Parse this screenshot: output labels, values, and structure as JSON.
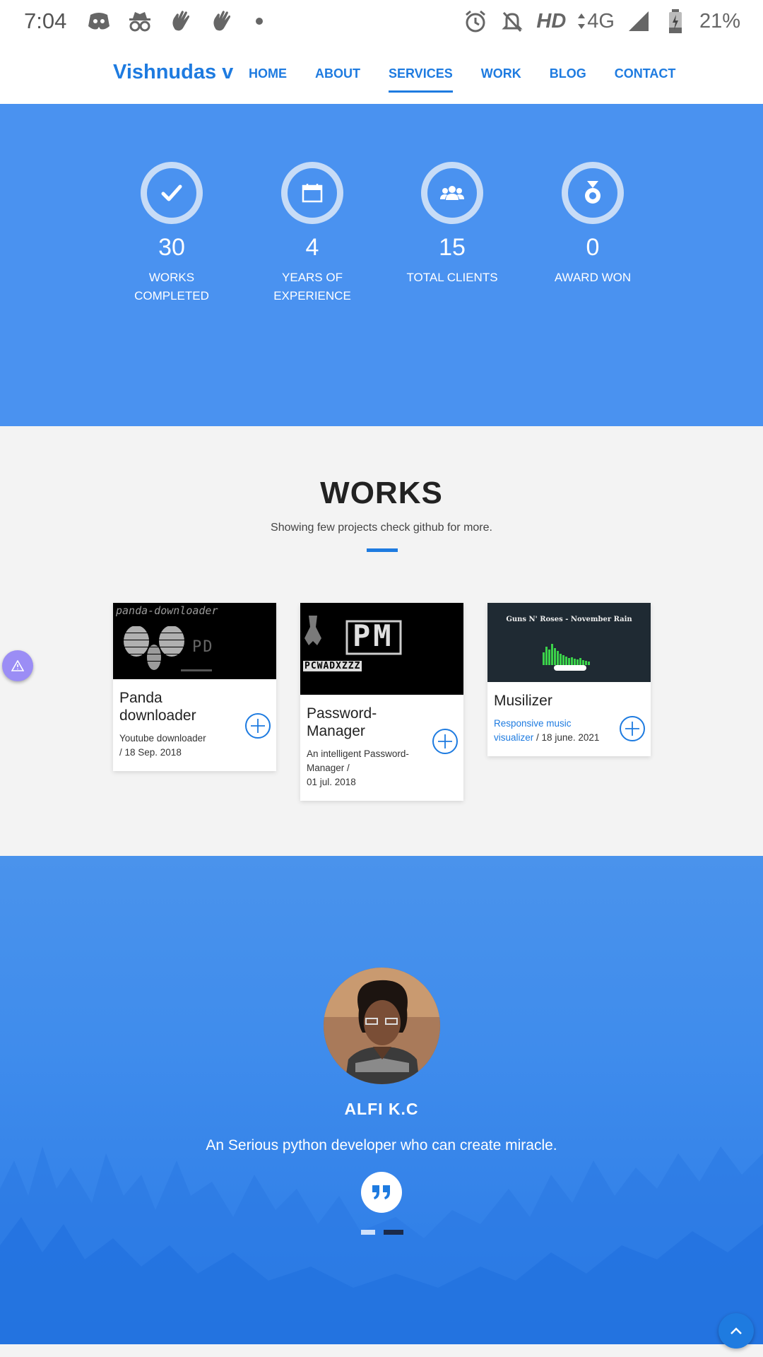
{
  "status_bar": {
    "time": "7:04",
    "network_label": "HD",
    "network_type": "4G",
    "battery": "21%",
    "icons": [
      "discord-icon",
      "incognito-icon",
      "wave-hand-icon",
      "wave-hand-icon",
      "dot-icon",
      "alarm-icon",
      "bell-off-icon",
      "signal-icon",
      "battery-icon"
    ]
  },
  "header": {
    "brand": "Vishnudas v",
    "nav": [
      {
        "label": "HOME"
      },
      {
        "label": "ABOUT"
      },
      {
        "label": "SERVICES",
        "active": true
      },
      {
        "label": "WORK"
      },
      {
        "label": "BLOG"
      },
      {
        "label": "CONTACT"
      }
    ]
  },
  "stats": [
    {
      "icon": "check-icon",
      "value": "30",
      "label": "WORKS COMPLETED"
    },
    {
      "icon": "calendar-icon",
      "value": "4",
      "label": "YEARS OF EXPERIENCE"
    },
    {
      "icon": "users-icon",
      "value": "15",
      "label": "TOTAL CLIENTS"
    },
    {
      "icon": "medal-icon",
      "value": "0",
      "label": "AWARD WON"
    }
  ],
  "works": {
    "title": "WORKS",
    "subtitle": "Showing few projects check github for more.",
    "cards": [
      {
        "title": "Panda downloader",
        "desc": "Youtube downloader",
        "date": "/ 18 Sep. 2018",
        "image_text": "panda-downloader",
        "image_badge": "PD"
      },
      {
        "title": "Password-Manager",
        "desc": "An intelligent Password-Manager /",
        "date": "01 jul. 2018",
        "image_text": "PCWADXZZZ",
        "image_badge": "PM"
      },
      {
        "title": "Musilizer",
        "desc_link": "Responsive music visualizer",
        "date": "/ 18 june. 2021",
        "image_text": "Guns N' Roses - November Rain"
      }
    ]
  },
  "testimonial": {
    "name": "ALFI K.C",
    "quote": "An Serious python developer who can create miracle.",
    "slides": 2,
    "active_slide": 2
  },
  "colors": {
    "accent": "#1e7be0",
    "stats_bg": "#4a92f0",
    "testimonial_bg": "#3f8cec"
  }
}
